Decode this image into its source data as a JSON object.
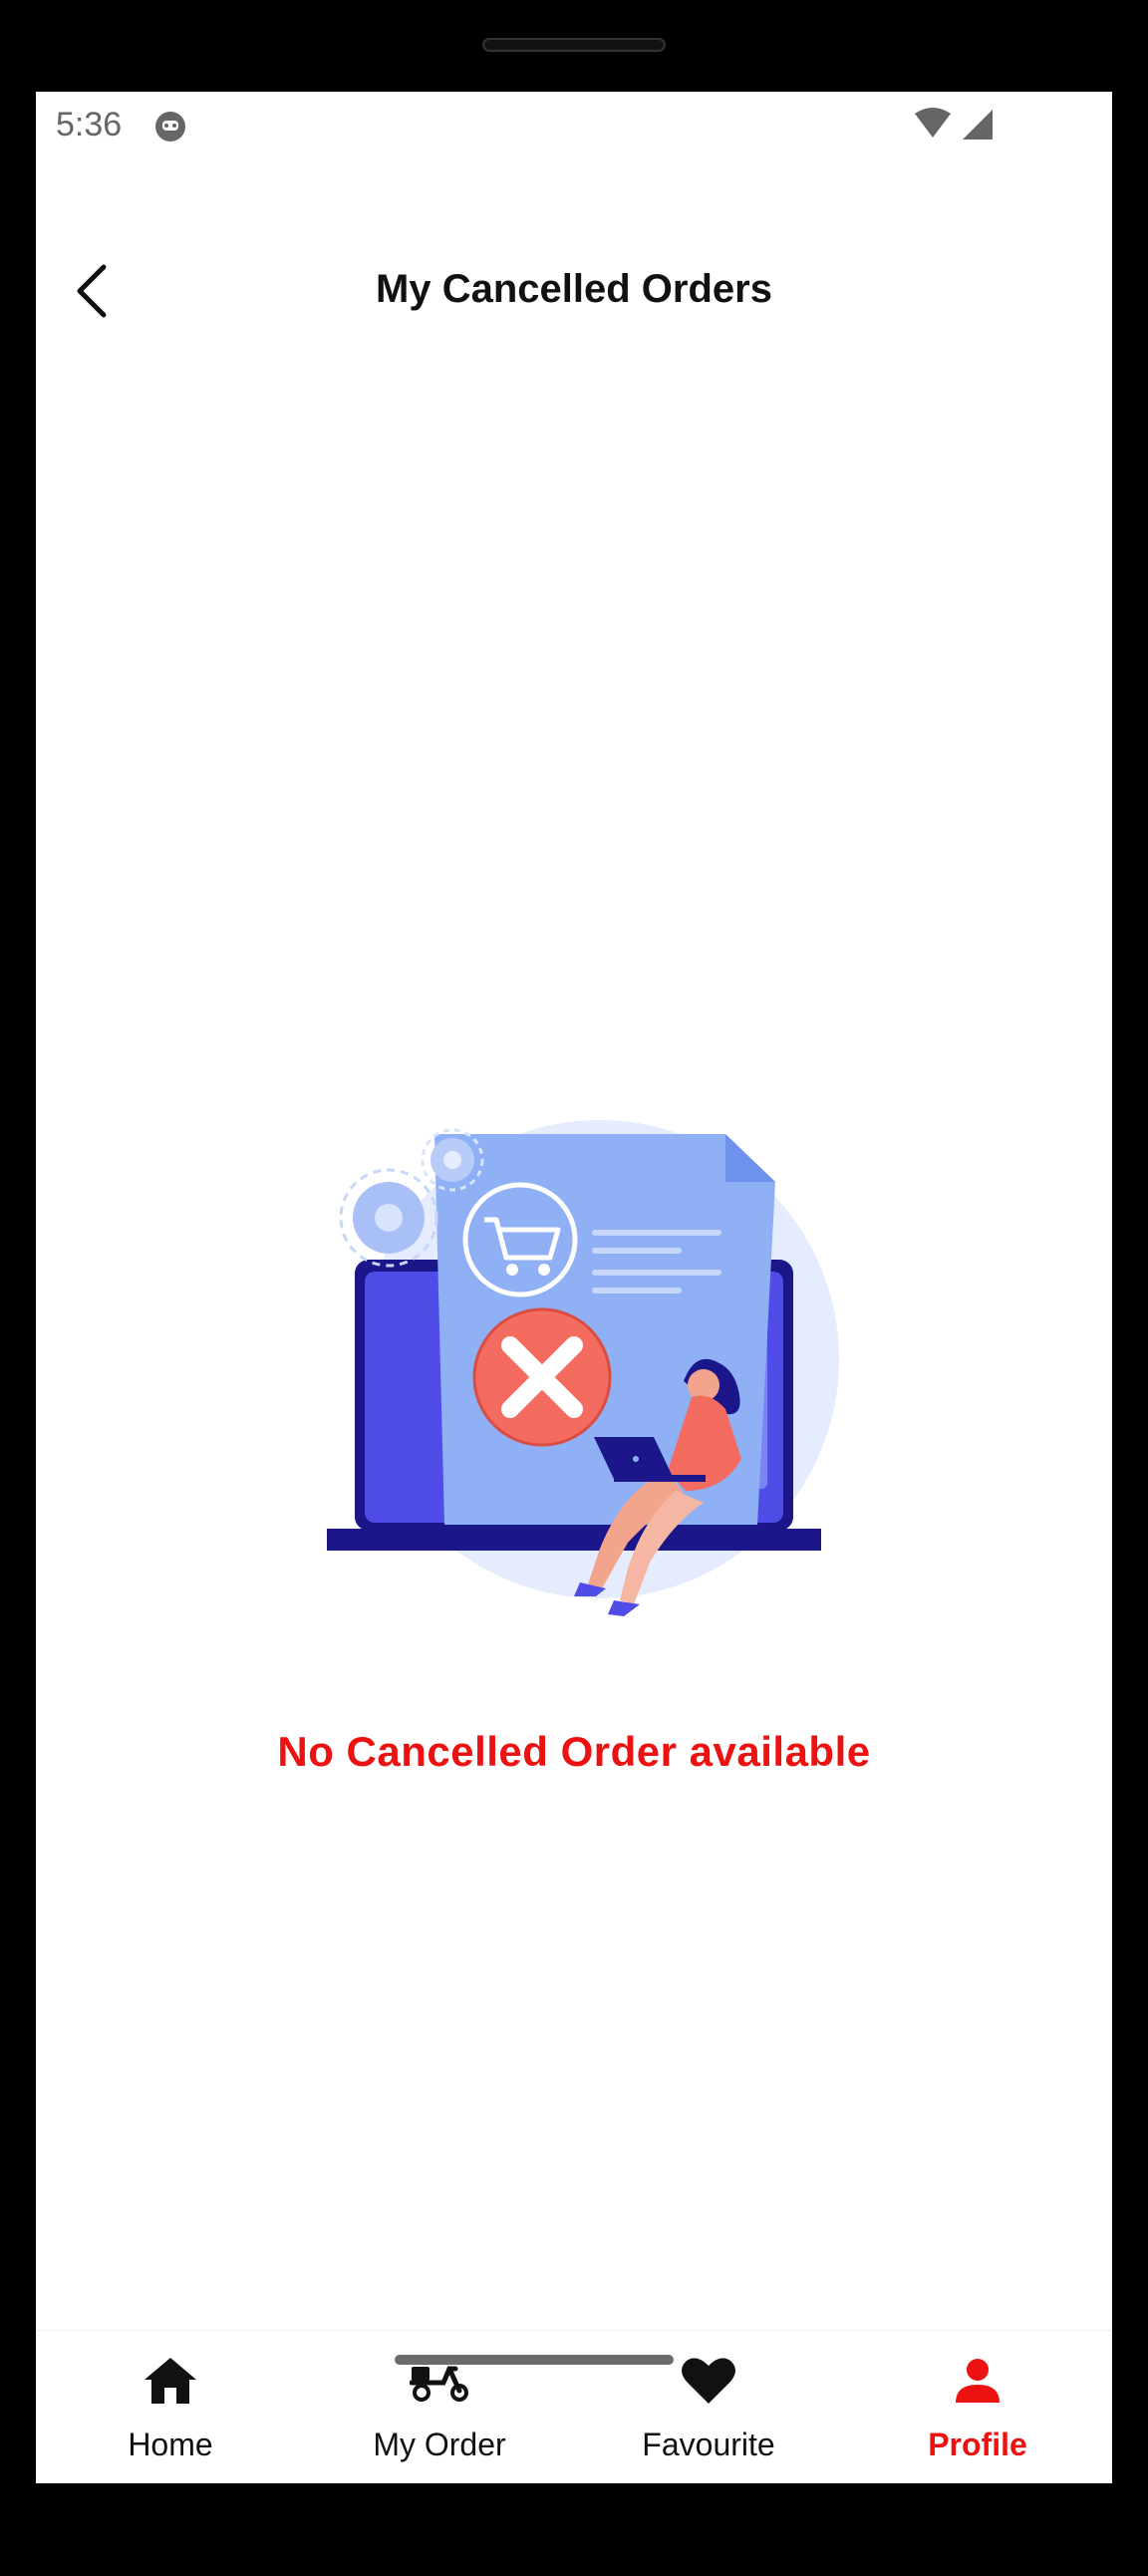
{
  "status_bar": {
    "time": "5:36"
  },
  "header": {
    "title": "My Cancelled Orders"
  },
  "empty_state": {
    "message": "No Cancelled Order available"
  },
  "bottom_nav": {
    "items": [
      {
        "label": "Home",
        "icon": "home-icon"
      },
      {
        "label": "My Order",
        "icon": "scooter-icon"
      },
      {
        "label": "Favourite",
        "icon": "heart-icon"
      },
      {
        "label": "Profile",
        "icon": "person-icon"
      }
    ],
    "active": "Profile"
  },
  "colors": {
    "accent": "#ec1212",
    "illustration_primary": "#4f4ce8",
    "illustration_light": "#8fb0f5",
    "background": "#ffffff"
  }
}
